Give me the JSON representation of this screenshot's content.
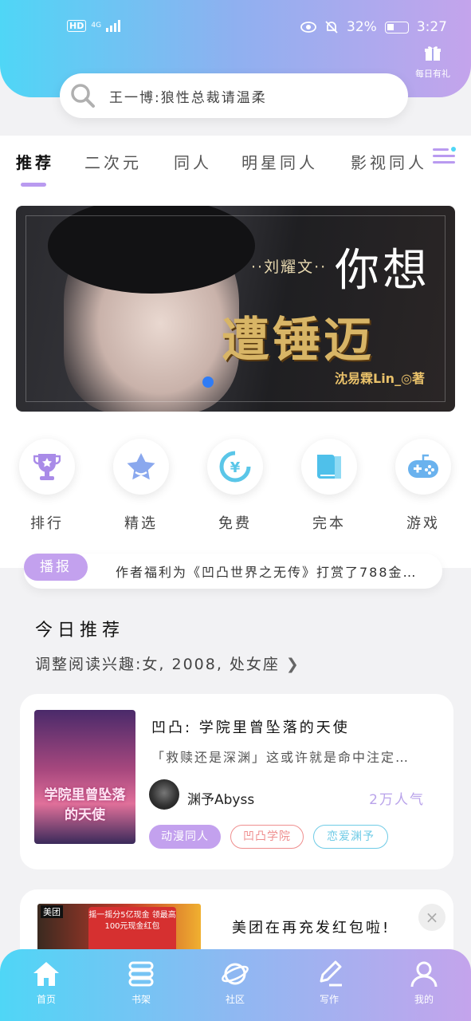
{
  "status_bar": {
    "hd": "HD",
    "network": "4G",
    "battery_percent": "32%",
    "time": "3:27"
  },
  "header": {
    "gift_label": "每日有礼",
    "search_placeholder": "王一博:狼性总裁请温柔"
  },
  "tabs": [
    {
      "label": "推荐",
      "active": true
    },
    {
      "label": "二次元",
      "active": false
    },
    {
      "label": "同人",
      "active": false
    },
    {
      "label": "明星同人",
      "active": false
    },
    {
      "label": "影视同人",
      "active": false
    }
  ],
  "banner": {
    "subtitle": "··刘耀文··",
    "title_top": "你想",
    "title_bottom": "遭锤迈",
    "author": "沈易霖Lin_◎著"
  },
  "quick_links": [
    {
      "label": "排行",
      "icon": "trophy-icon"
    },
    {
      "label": "精选",
      "icon": "star-icon"
    },
    {
      "label": "免费",
      "icon": "yuan-icon"
    },
    {
      "label": "完本",
      "icon": "book-icon"
    },
    {
      "label": "游戏",
      "icon": "gamepad-icon"
    }
  ],
  "notice": {
    "tag": "播报",
    "text": "作者福利为《凹凸世界之无传》打赏了788金…"
  },
  "recommend": {
    "heading": "今日推荐",
    "preference": "调整阅读兴趣:女, 2008, 处女座"
  },
  "book": {
    "cover_text": "学院里曾坠落的天使",
    "title": "凹凸: 学院里曾坠落的天使",
    "description": "「救赎还是深渊」这或许就是命中注定…",
    "author": "渊予Abyss",
    "reads": "2万人气",
    "tags": [
      "动漫同人",
      "凹凸学院",
      "恋爱渊予"
    ]
  },
  "ad": {
    "brand": "美团",
    "image_text": "摇一摇分5亿现金 领最高100元现金红包",
    "text": "美团在再充发红包啦!",
    "close": "×"
  },
  "bottom_nav": [
    {
      "label": "首页",
      "icon": "home-icon"
    },
    {
      "label": "书架",
      "icon": "bookshelf-icon"
    },
    {
      "label": "社区",
      "icon": "planet-icon"
    },
    {
      "label": "写作",
      "icon": "pen-icon"
    },
    {
      "label": "我的",
      "icon": "user-icon"
    }
  ],
  "colors": {
    "accent": "#c3a1ee",
    "cyan": "#4fd6f6",
    "chip_red": "#ef8e8e",
    "chip_cyan": "#6fcbe6"
  }
}
